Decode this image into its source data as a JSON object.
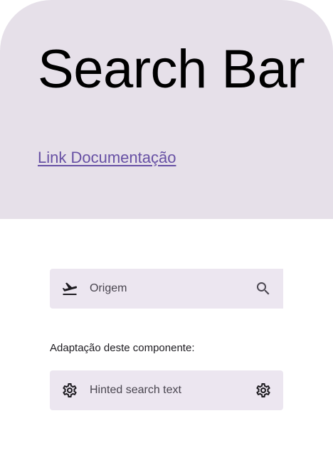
{
  "hero": {
    "title": "Search Bar",
    "link_label": "Link Documentação"
  },
  "search_bar_1": {
    "leading_icon": "flight-takeoff-icon",
    "placeholder": "Origem",
    "trailing_icon": "search-icon"
  },
  "section": {
    "label": "Adaptação deste componente:"
  },
  "search_bar_2": {
    "leading_icon": "settings-icon",
    "placeholder": "Hinted search text",
    "trailing_icon": "settings-icon"
  },
  "colors": {
    "hero_background": "#e6e0e9",
    "search_bar_background": "#ece6f0",
    "link": "#6750a4",
    "placeholder_text": "#49454f"
  }
}
